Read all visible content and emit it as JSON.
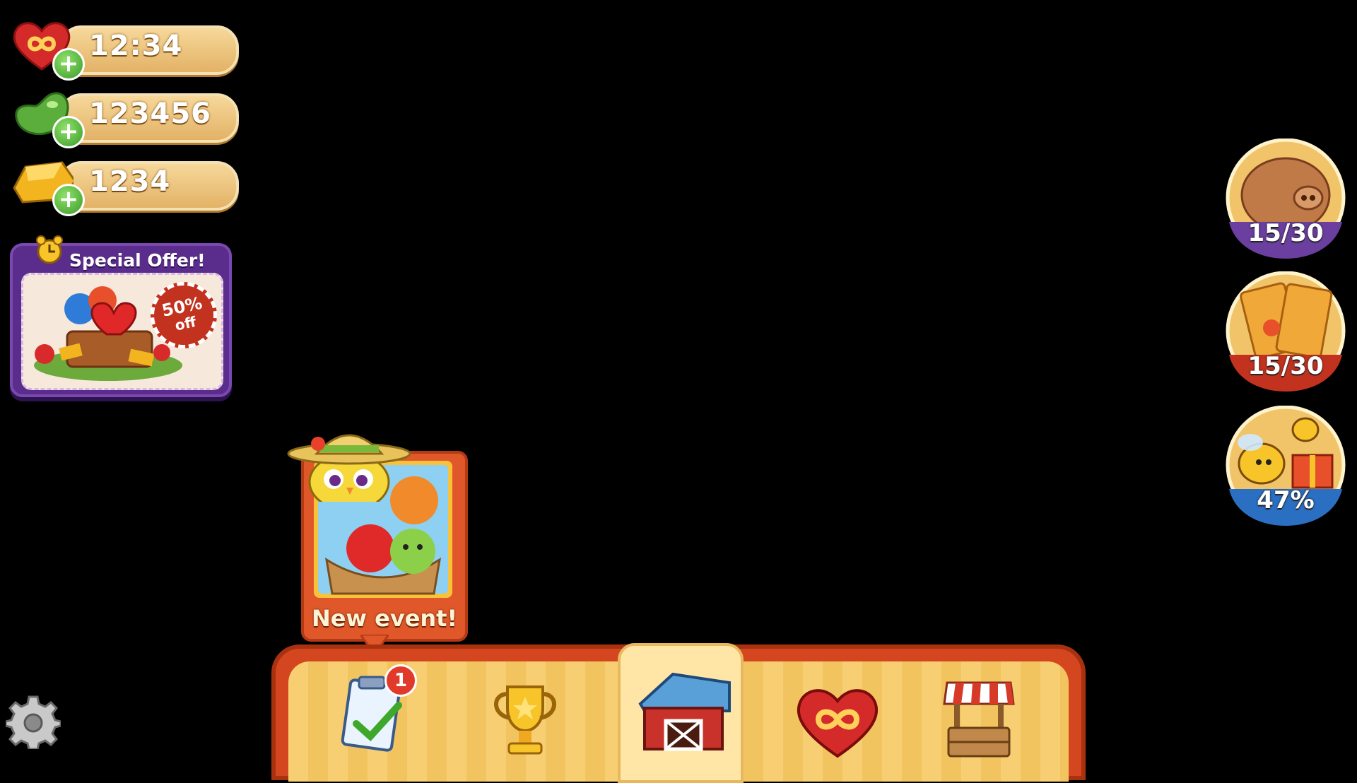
{
  "resources": {
    "lives": {
      "value": "12:34",
      "icon": "infinite-heart-icon"
    },
    "beans": {
      "value": "123456",
      "icon": "bean-icon"
    },
    "gold": {
      "value": "1234",
      "icon": "gold-bar-icon"
    }
  },
  "special_offer": {
    "title": "Special Offer!",
    "discount_line1": "50%",
    "discount_line2": "off"
  },
  "progress_badges": {
    "piggy_bank": {
      "value": "15/30",
      "color": "#6b3fa0"
    },
    "cards": {
      "value": "15/30",
      "color": "#c2321f"
    },
    "bees": {
      "value": "47%",
      "color": "#2a6fc2"
    }
  },
  "event": {
    "label": "New event!"
  },
  "nav": {
    "quests_badge": "1",
    "selected": "farm"
  },
  "colors": {
    "pill_gold": "#e3b266",
    "bar_red": "#d4461f",
    "offer_purple": "#5a2d8c"
  }
}
